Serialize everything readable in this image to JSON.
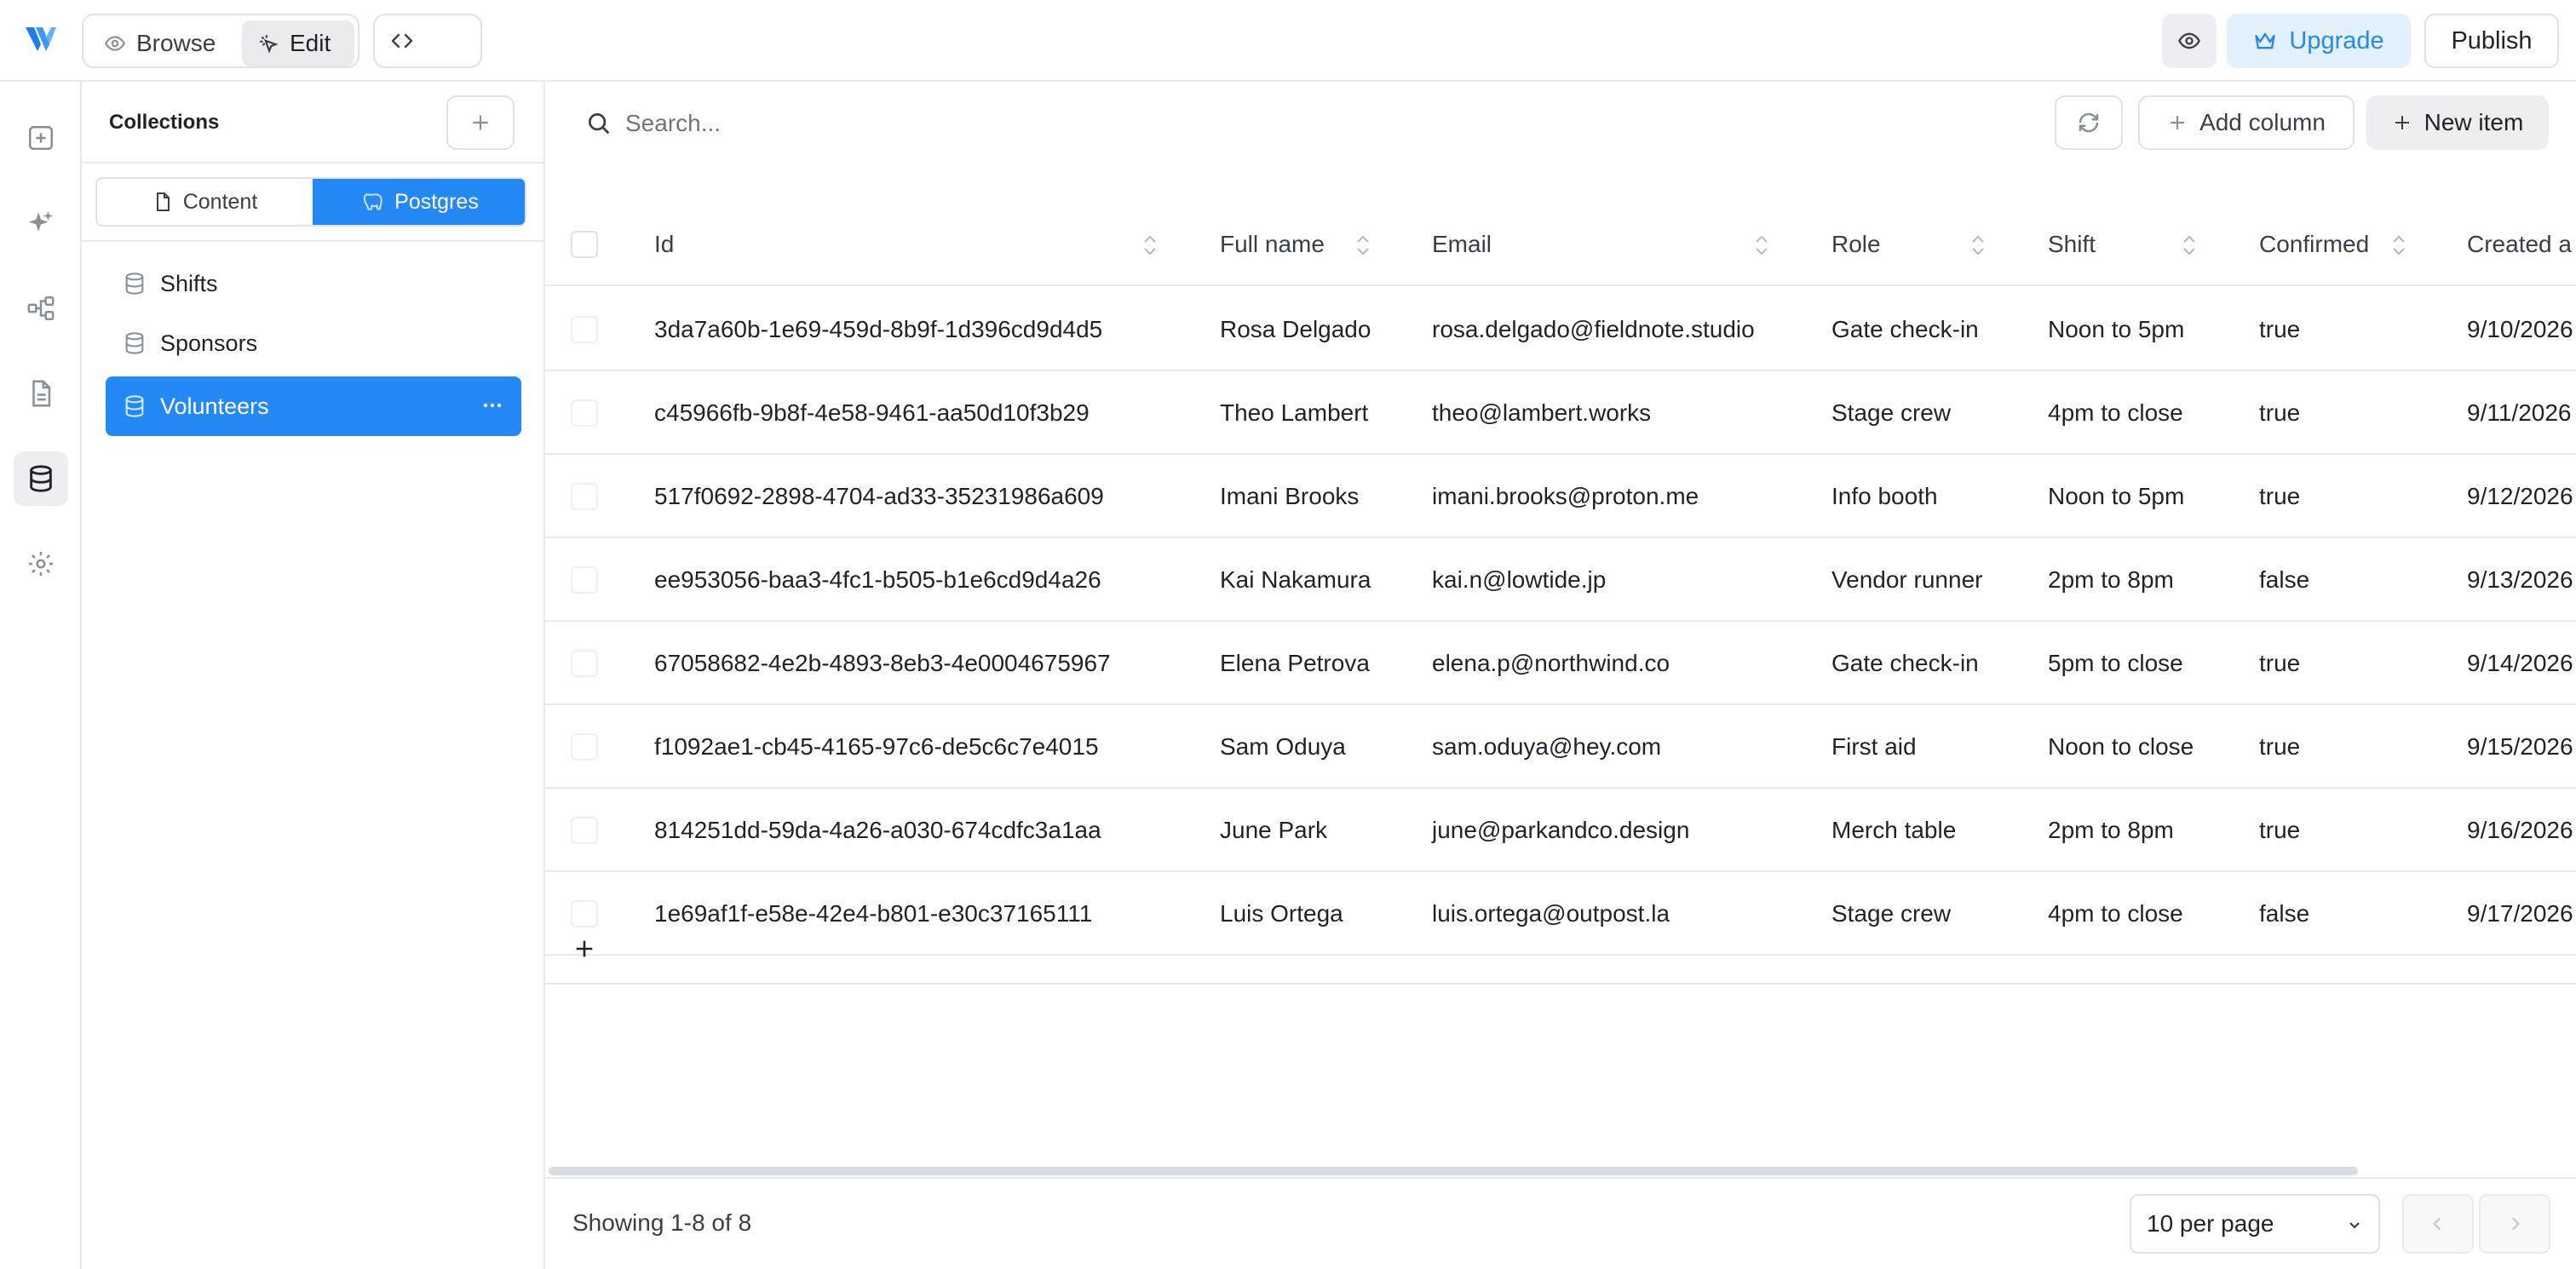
{
  "topbar": {
    "logo": "logo-mark",
    "mode_browse": "Browse",
    "mode_edit": "Edit",
    "upgrade": "Upgrade",
    "publish": "Publish"
  },
  "rail": {
    "icons": [
      "add-square-icon",
      "sparkle-icon",
      "flow-icon",
      "document-icon",
      "database-icon",
      "gear-icon"
    ],
    "active": "database-icon"
  },
  "collections": {
    "title": "Collections",
    "tabs": [
      {
        "label": "Content",
        "active": false
      },
      {
        "label": "Postgres",
        "active": true
      }
    ],
    "items": [
      {
        "label": "Shifts",
        "active": false
      },
      {
        "label": "Sponsors",
        "active": false
      },
      {
        "label": "Volunteers",
        "active": true
      }
    ]
  },
  "toolbar": {
    "search_placeholder": "Search...",
    "add_column": "Add column",
    "new_item": "New item"
  },
  "table": {
    "columns": [
      "Id",
      "Full name",
      "Email",
      "Role",
      "Shift",
      "Confirmed",
      "Created a"
    ],
    "rows": [
      [
        "3da7a60b-1e69-459d-8b9f-1d396cd9d4d5",
        "Rosa Delgado",
        "rosa.delgado@fieldnote.studio",
        "Gate check-in",
        "Noon to 5pm",
        "true",
        "9/10/2026"
      ],
      [
        "c45966fb-9b8f-4e58-9461-aa50d10f3b29",
        "Theo Lambert",
        "theo@lambert.works",
        "Stage crew",
        "4pm to close",
        "true",
        "9/11/2026"
      ],
      [
        "517f0692-2898-4704-ad33-35231986a609",
        "Imani Brooks",
        "imani.brooks@proton.me",
        "Info booth",
        "Noon to 5pm",
        "true",
        "9/12/2026"
      ],
      [
        "ee953056-baa3-4fc1-b505-b1e6cd9d4a26",
        "Kai Nakamura",
        "kai.n@lowtide.jp",
        "Vendor runner",
        "2pm to 8pm",
        "false",
        "9/13/2026"
      ],
      [
        "67058682-4e2b-4893-8eb3-4e0004675967",
        "Elena Petrova",
        "elena.p@northwind.co",
        "Gate check-in",
        "5pm to close",
        "true",
        "9/14/2026"
      ],
      [
        "f1092ae1-cb45-4165-97c6-de5c6c7e4015",
        "Sam Oduya",
        "sam.oduya@hey.com",
        "First aid",
        "Noon to close",
        "true",
        "9/15/2026"
      ],
      [
        "814251dd-59da-4a26-a030-674cdfc3a1aa",
        "June Park",
        "june@parkandco.design",
        "Merch table",
        "2pm to 8pm",
        "true",
        "9/16/2026"
      ],
      [
        "1e69af1f-e58e-42e4-b801-e30c37165111",
        "Luis Ortega",
        "luis.ortega@outpost.la",
        "Stage crew",
        "4pm to close",
        "false",
        "9/17/2026"
      ]
    ]
  },
  "footer": {
    "showing": "Showing 1-8 of 8",
    "per_page": "10 per page"
  },
  "colors": {
    "accent": "#2489f5",
    "upgrade_bg": "#e3f0fd",
    "border": "#e8eaed"
  }
}
